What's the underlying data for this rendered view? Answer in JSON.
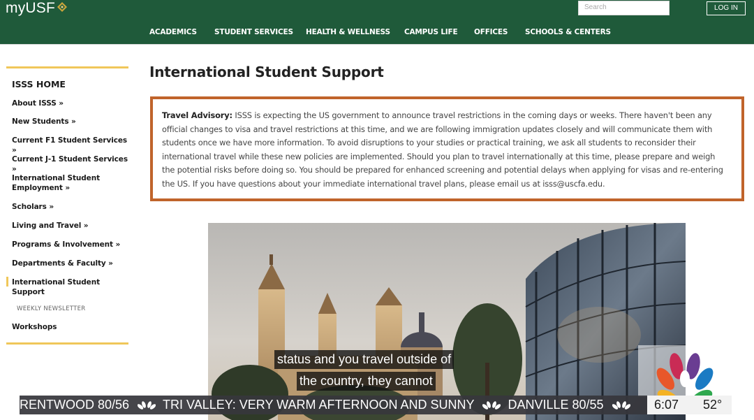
{
  "header": {
    "logo": "myUSF",
    "search_placeholder": "Search",
    "login_label": "LOG IN",
    "nav": [
      "ACADEMICS",
      "STUDENT SERVICES",
      "HEALTH & WELLNESS",
      "CAMPUS LIFE",
      "OFFICES",
      "SCHOOLS & CENTERS"
    ]
  },
  "sidebar": {
    "title": "ISSS HOME",
    "items": [
      "About ISSS »",
      "New Students »",
      "Current F1 Student Services »",
      "Current J-1 Student Services »",
      "International Student Employment »",
      "Scholars »",
      "Living and Travel »",
      "Programs & Involvement »",
      "Departments & Faculty »",
      "International Student Support",
      "WEEKLY NEWSLETTER",
      "Workshops"
    ]
  },
  "main": {
    "title": "International Student Support",
    "advisory_label": "Travel Advisory:",
    "advisory_body": " ISSS is expecting the US government to announce travel restrictions in the coming days or weeks. There haven't been any official changes to visa and travel restrictions at this time, and we are following immigration updates closely and will communicate them with students once we have more information. To avoid disruptions to your studies or practical training, we ask all students to reconsider their international travel while these new policies are implemented. Should you plan to travel internationally at this time, please prepare and weigh the potential risks before doing so. You should be prepared for enhanced screening and potential delays when applying for visas and re-entering the US. If you have questions about your immediate international travel plans, please email us at isss@uscfa.edu."
  },
  "broadcast": {
    "caption_line1": "status and you travel outside of",
    "caption_line2": "the country, they cannot",
    "ticker": [
      "RENTWOOD 80/56",
      "TRI VALLEY: VERY WARM AFTERNOON AND SUNNY",
      "DANVILLE 80/55"
    ],
    "time": "6:07",
    "temperature": "52°"
  },
  "colors": {
    "header_green": "#1f5a3a",
    "accent_gold": "#f0c75a",
    "advisory_border": "#c0642b"
  }
}
